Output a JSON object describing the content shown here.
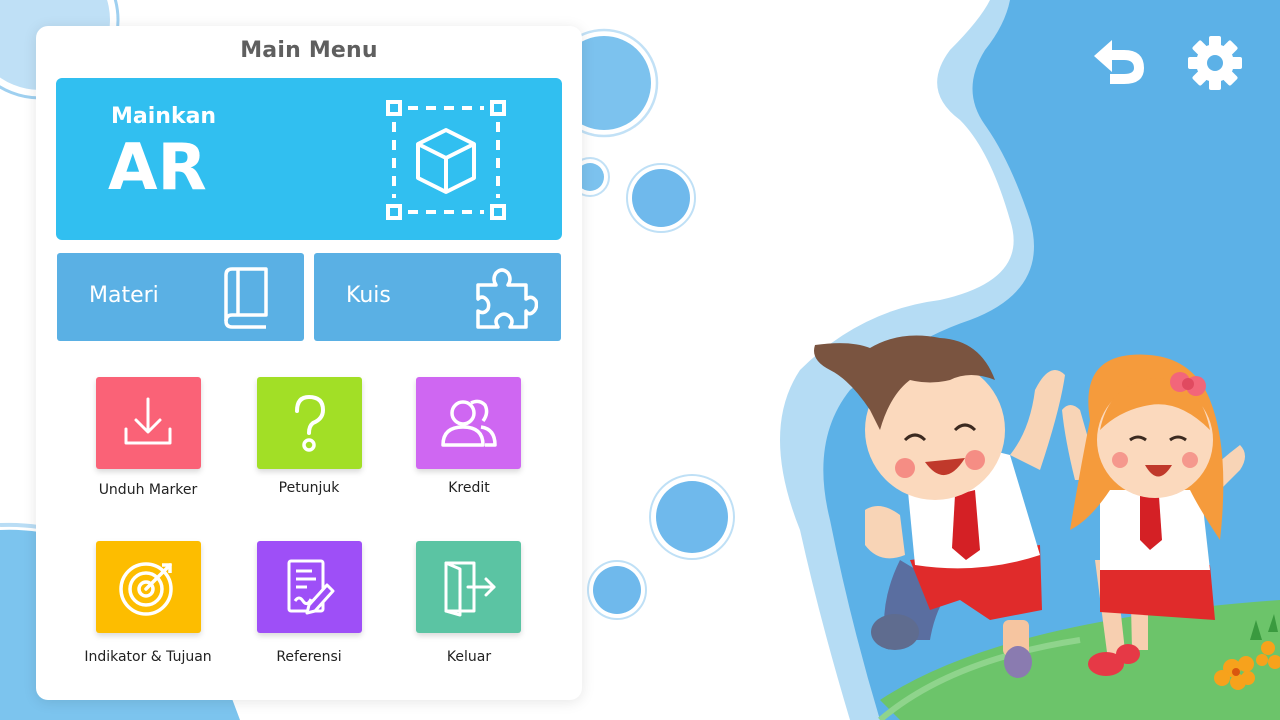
{
  "menu": {
    "title": "Main Menu",
    "ar": {
      "small": "Mainkan",
      "big": "AR",
      "icon": "ar-cube-icon"
    },
    "materi": {
      "label": "Materi",
      "icon": "book-icon"
    },
    "kuis": {
      "label": "Kuis",
      "icon": "puzzle-icon"
    },
    "tiles": [
      {
        "label": "Unduh Marker",
        "color": "#fa6277",
        "icon": "download-icon"
      },
      {
        "label": "Petunjuk",
        "color": "#a2df26",
        "icon": "question-icon"
      },
      {
        "label": "Kredit",
        "color": "#cf67f2",
        "icon": "users-icon"
      },
      {
        "label": "Indikator & Tujuan",
        "color": "#fdbd00",
        "icon": "target-icon"
      },
      {
        "label": "Referensi",
        "color": "#9e4ff7",
        "icon": "document-icon"
      },
      {
        "label": "Keluar",
        "color": "#5bc4a3",
        "icon": "exit-icon"
      }
    ]
  },
  "top_icons": {
    "back": "undo-icon",
    "settings": "gear-icon"
  },
  "colors": {
    "ar_card": "#31bff0",
    "half_card": "#5ab0e4",
    "sky": "#5cb1e7",
    "grass": "#6cc46a"
  }
}
